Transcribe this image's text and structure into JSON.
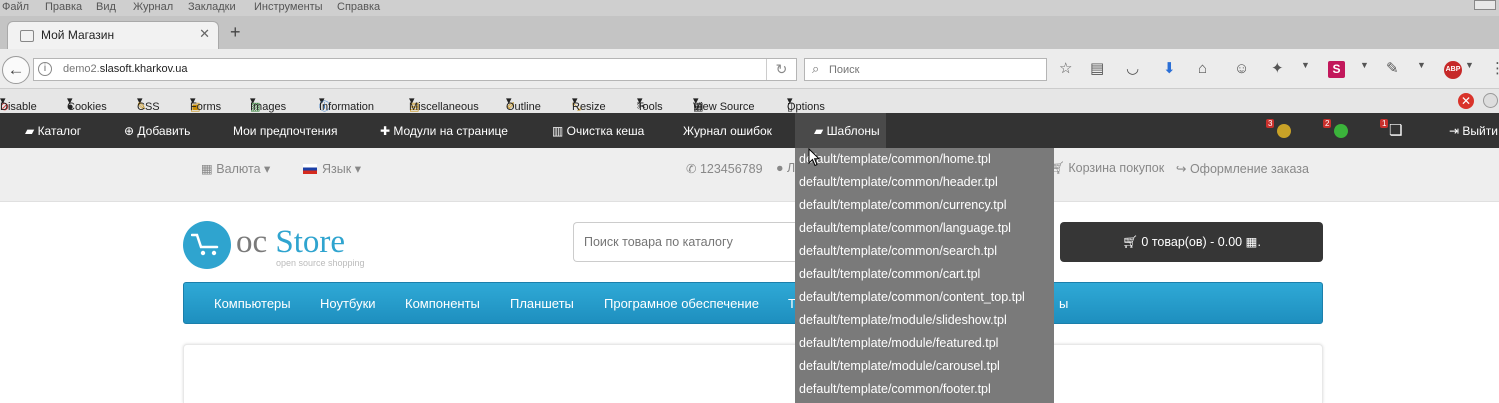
{
  "browser": {
    "menu": [
      "Файл",
      "Правка",
      "Вид",
      "Журнал",
      "Закладки",
      "Инструменты",
      "Справка"
    ],
    "tab": {
      "title": "Мой Магазин",
      "close": "✕"
    },
    "new_tab": "+",
    "url": {
      "prefix": "demo2.",
      "domain": "slasoft.kharkov.ua"
    },
    "search_placeholder": "Поиск",
    "abp_label": "ABP",
    "s_label": "S"
  },
  "webdev": [
    "Disable",
    "Cookies",
    "CSS",
    "Forms",
    "Images",
    "Information",
    "Miscellaneous",
    "Outline",
    "Resize",
    "Tools",
    "View Source",
    "Options"
  ],
  "admin": {
    "items": [
      "Каталог",
      "Добавить",
      "Мои предпочтения",
      "Модули на странице",
      "Очистка кеша",
      "Журнал ошибок",
      "Шаблоны"
    ],
    "badges": [
      "3",
      "2",
      "1"
    ],
    "logout": "Выйти"
  },
  "shop": {
    "currency": "Валюта",
    "language": "Язык",
    "phone": "123456789",
    "account_initial": "Л",
    "cart_link": "Корзина покупок",
    "checkout_link": "Оформление заказа",
    "logo": {
      "oc": "oc",
      "store": "Store",
      "tagline": "open source shopping"
    },
    "search_placeholder": "Поиск товара по каталогу",
    "cart_button": "0 товар(ов) - 0.00",
    "categories": [
      "Компьютеры",
      "Ноутбуки",
      "Компоненты",
      "Планшеты",
      "Програмное обеспечение",
      "Т",
      "ы"
    ]
  },
  "templates_dropdown": [
    "default/template/common/home.tpl",
    "default/template/common/header.tpl",
    "default/template/common/currency.tpl",
    "default/template/common/language.tpl",
    "default/template/common/search.tpl",
    "default/template/common/cart.tpl",
    "default/template/common/content_top.tpl",
    "default/template/module/slideshow.tpl",
    "default/template/module/featured.tpl",
    "default/template/module/carousel.tpl",
    "default/template/common/footer.tpl"
  ],
  "colors": {
    "accent": "#2fa4cf",
    "admin_bar": "#333333",
    "dropdown": "#7a7a7a",
    "cart": "#363636"
  }
}
